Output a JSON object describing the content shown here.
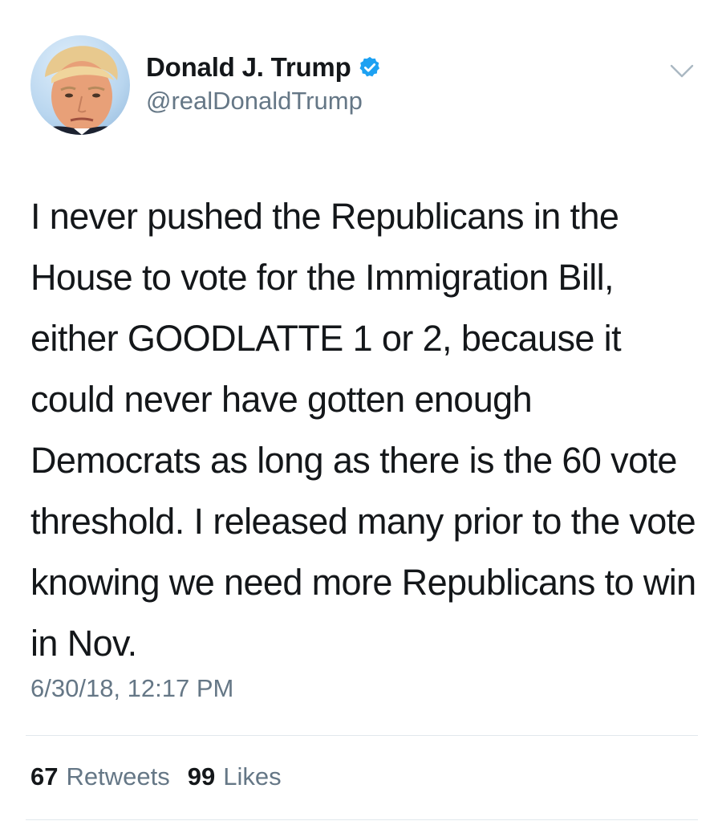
{
  "tweet": {
    "author": {
      "display_name": "Donald J. Trump",
      "handle": "@realDonaldTrump",
      "verified": true,
      "avatar_icon": "profile-photo"
    },
    "text": "I never pushed the Republicans in the House to vote for the Immigration Bill, either GOODLATTE 1 or 2, because it could never have gotten enough Democrats as long as there is the 60 vote threshold. I released many prior to the vote knowing we need more Republicans to win in Nov.",
    "timestamp": "6/30/18, 12:17 PM",
    "stats": {
      "retweets": {
        "count": "67",
        "label": "Retweets"
      },
      "likes": {
        "count": "99",
        "label": "Likes"
      }
    },
    "menu_icon": "chevron-down-icon"
  },
  "colors": {
    "text": "#14171a",
    "secondary": "#657786",
    "verified_blue": "#1da1f2",
    "divider": "#e1e8ed"
  }
}
